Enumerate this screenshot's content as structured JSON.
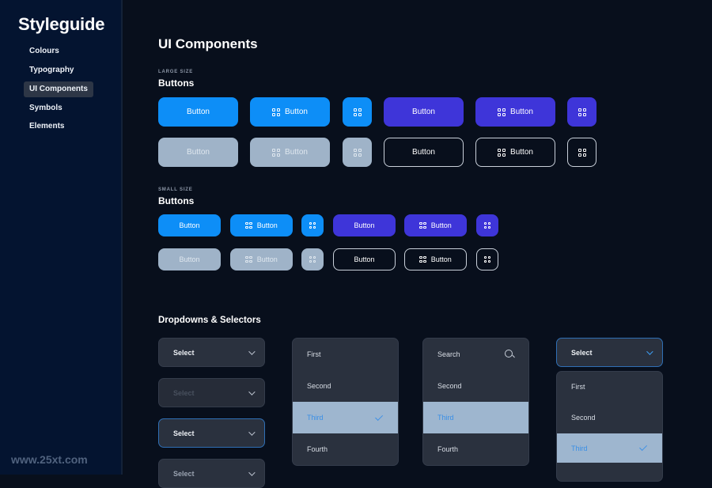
{
  "sidebar": {
    "brand": "Styleguide",
    "items": [
      {
        "label": "Colours"
      },
      {
        "label": "Typography"
      },
      {
        "label": "UI Components",
        "active": true
      },
      {
        "label": "Symbols"
      },
      {
        "label": "Elements"
      }
    ],
    "watermark": "www.25xt.com"
  },
  "main": {
    "title": "UI Components",
    "large": {
      "eyebrow": "LARGE SIZE",
      "title": "Buttons",
      "button_label": "Button"
    },
    "small": {
      "eyebrow": "SMALL SIZE",
      "title": "Buttons",
      "button_label": "Button"
    },
    "dropdowns": {
      "title": "Dropdowns & Selectors",
      "selects": [
        {
          "label": "Select",
          "state": "default"
        },
        {
          "label": "Select",
          "state": "disabled"
        },
        {
          "label": "Select",
          "state": "focused"
        },
        {
          "label": "Select",
          "state": "default"
        }
      ],
      "list_one": {
        "items": [
          "First",
          "Second",
          "Third",
          "Fourth"
        ],
        "selected": "Third"
      },
      "list_search": {
        "placeholder": "Search",
        "items": [
          "Second",
          "Third",
          "Fourth"
        ],
        "selected": "Third"
      },
      "open_select": {
        "label": "Select",
        "items": [
          "First",
          "Second",
          "Third"
        ],
        "selected": "Third"
      }
    }
  },
  "colors": {
    "primary": "#0d8ef7",
    "indigo": "#3e35d9",
    "disabled": "#9fb3c8",
    "outline": "#c9d0da",
    "background": "#080f1c",
    "sidebar": "#041430",
    "select_bg": "#2a313e",
    "selected_item": "#9eb6cf",
    "selected_text": "#3a8fe6"
  }
}
